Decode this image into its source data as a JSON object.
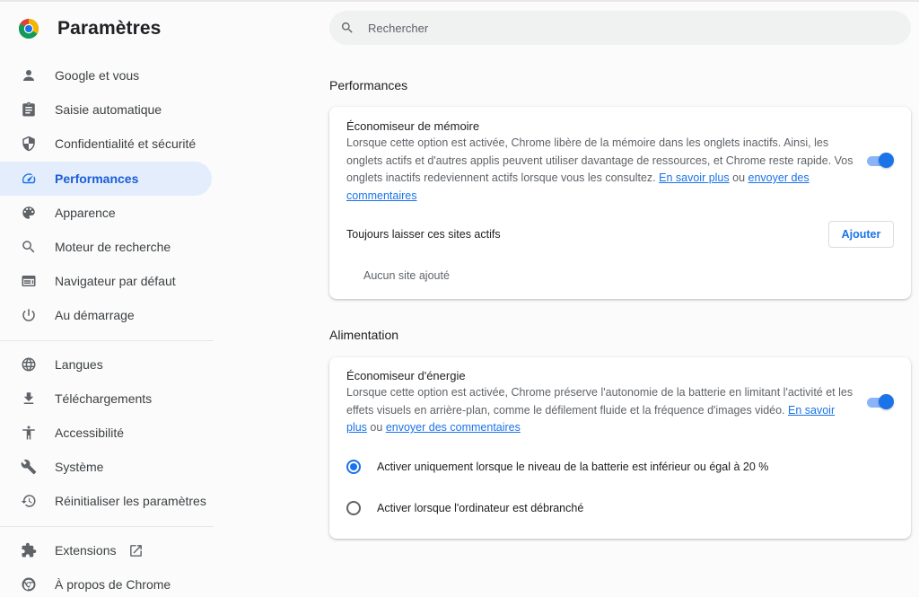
{
  "app": {
    "title": "Paramètres"
  },
  "search": {
    "placeholder": "Rechercher",
    "value": ""
  },
  "sidebar": {
    "items": [
      {
        "label": "Google et vous",
        "icon": "person-icon"
      },
      {
        "label": "Saisie automatique",
        "icon": "clipboard-icon"
      },
      {
        "label": "Confidentialité et sécurité",
        "icon": "shield-icon"
      },
      {
        "label": "Performances",
        "icon": "speedometer-icon",
        "active": true
      },
      {
        "label": "Apparence",
        "icon": "palette-icon"
      },
      {
        "label": "Moteur de recherche",
        "icon": "search-icon"
      },
      {
        "label": "Navigateur par défaut",
        "icon": "browser-window-icon"
      },
      {
        "label": "Au démarrage",
        "icon": "power-icon"
      },
      {
        "label": "Langues",
        "icon": "globe-icon"
      },
      {
        "label": "Téléchargements",
        "icon": "download-icon"
      },
      {
        "label": "Accessibilité",
        "icon": "accessibility-icon"
      },
      {
        "label": "Système",
        "icon": "wrench-icon"
      },
      {
        "label": "Réinitialiser les paramètres",
        "icon": "restore-icon"
      },
      {
        "label": "Extensions",
        "icon": "puzzle-icon",
        "external": true
      },
      {
        "label": "À propos de Chrome",
        "icon": "chrome-icon"
      }
    ]
  },
  "performances": {
    "section_title": "Performances",
    "memory_saver": {
      "title": "Économiseur de mémoire",
      "description": "Lorsque cette option est activée, Chrome libère de la mémoire dans les onglets inactifs. Ainsi, les onglets actifs et d'autres applis peuvent utiliser davantage de ressources, et Chrome reste rapide. Vos onglets inactifs redeviennent actifs lorsque vous les consultez.",
      "learn_more": "En savoir plus",
      "or": "ou",
      "feedback": "envoyer des commentaires",
      "enabled": true
    },
    "always_active": {
      "label": "Toujours laisser ces sites actifs",
      "add_button": "Ajouter",
      "empty_text": "Aucun site ajouté"
    }
  },
  "power": {
    "section_title": "Alimentation",
    "energy_saver": {
      "title": "Économiseur d'énergie",
      "description": "Lorsque cette option est activée, Chrome préserve l'autonomie de la batterie en limitant l'activité et les effets visuels en arrière-plan, comme le défilement fluide et la fréquence d'images vidéo.",
      "learn_more": "En savoir plus",
      "or": "ou",
      "feedback": "envoyer des commentaires",
      "enabled": true
    },
    "options": [
      {
        "label": "Activer uniquement lorsque le niveau de la batterie est inférieur ou égal à 20 %",
        "checked": true
      },
      {
        "label": "Activer lorsque l'ordinateur est débranché",
        "checked": false
      }
    ]
  },
  "colors": {
    "accent": "#1a73e8",
    "active_nav_bg": "#e3edfc",
    "toggle_track": "#8ab4f8"
  }
}
